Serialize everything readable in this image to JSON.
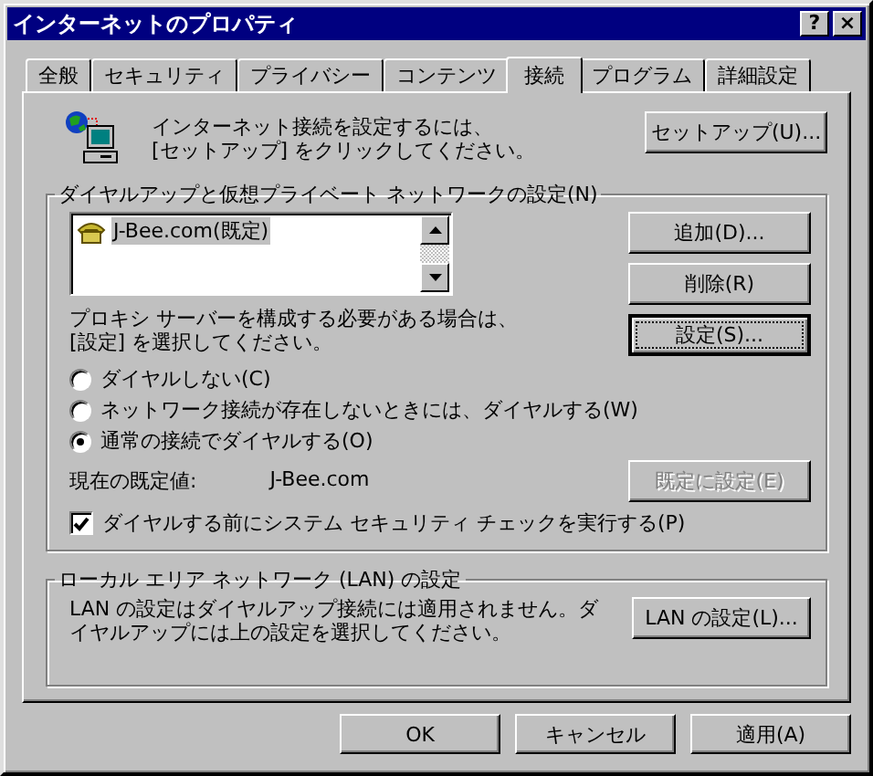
{
  "window": {
    "title": "インターネットのプロパティ",
    "help_button": "?",
    "close_button": "×"
  },
  "tabs": [
    {
      "label": "全般",
      "selected": false
    },
    {
      "label": "セキュリティ",
      "selected": false
    },
    {
      "label": "プライバシー",
      "selected": false
    },
    {
      "label": "コンテンツ",
      "selected": false
    },
    {
      "label": "接続",
      "selected": true
    },
    {
      "label": "プログラム",
      "selected": false
    },
    {
      "label": "詳細設定",
      "selected": false
    }
  ],
  "intro": {
    "text": "インターネット接続を設定するには、\n[セットアップ] をクリックしてください。",
    "setup_button": "セットアップ(U)..."
  },
  "dialup": {
    "title": "ダイヤルアップと仮想プライベート ネットワークの設定(N)",
    "connections": [
      {
        "name": "J-Bee.com(既定)",
        "selected": true
      }
    ],
    "buttons": [
      {
        "label": "追加(D)...",
        "focused": false
      },
      {
        "label": "削除(R)",
        "focused": false
      },
      {
        "label": "設定(S)...",
        "focused": true
      }
    ],
    "proxy_text": "プロキシ サーバーを構成する必要がある場合は、\n[設定] を選択してください。",
    "radios": [
      {
        "label": "ダイヤルしない(C)",
        "selected": false
      },
      {
        "label": "ネットワーク接続が存在しないときには、ダイヤルする(W)",
        "selected": false
      },
      {
        "label": "通常の接続でダイヤルする(O)",
        "selected": true
      }
    ],
    "current_default_label": "現在の既定値:",
    "current_default_value": "J-Bee.com",
    "set_default_button": {
      "label": "既定に設定(E)",
      "disabled": true
    },
    "security_check": {
      "label": "ダイヤルする前にシステム セキュリティ チェックを実行する(P)",
      "checked": true
    }
  },
  "lan": {
    "title": "ローカル エリア ネットワーク (LAN) の設定",
    "text": "LAN の設定はダイヤルアップ接続には適用されません。ダイヤルアップには上の設定を選択してください。",
    "button": "LAN の設定(L)..."
  },
  "footer_buttons": [
    {
      "label": "OK"
    },
    {
      "label": "キャンセル"
    },
    {
      "label": "適用(A)"
    }
  ]
}
